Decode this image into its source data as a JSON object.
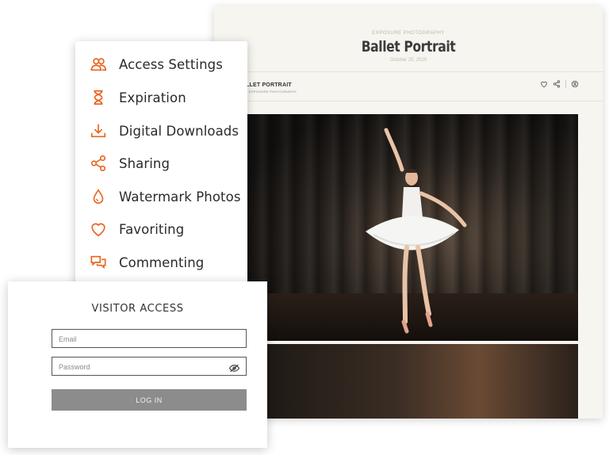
{
  "gallery": {
    "kicker": "EXPOSURE PHOTOGRAPHY",
    "title": "Ballet Portrait",
    "date": "October 20, 2020",
    "brand": "LLET PORTRAIT",
    "brand_sub": "EXPOSURE PHOTOGRAPHY",
    "nav_icons": [
      "heart-icon",
      "share-icon",
      "user-icon"
    ]
  },
  "menu": {
    "items": [
      {
        "label": "Access Settings",
        "icon": "users-icon"
      },
      {
        "label": "Expiration",
        "icon": "hourglass-icon"
      },
      {
        "label": "Digital Downloads",
        "icon": "download-icon"
      },
      {
        "label": "Sharing",
        "icon": "share-icon"
      },
      {
        "label": "Watermark Photos",
        "icon": "droplet-icon"
      },
      {
        "label": "Favoriting",
        "icon": "heart-icon"
      },
      {
        "label": "Commenting",
        "icon": "chat-bubbles-icon"
      }
    ],
    "accent": "#e8651d"
  },
  "access": {
    "heading": "VISITOR ACCESS",
    "email_placeholder": "Email",
    "password_placeholder": "Password",
    "login_label": "LOG IN"
  }
}
